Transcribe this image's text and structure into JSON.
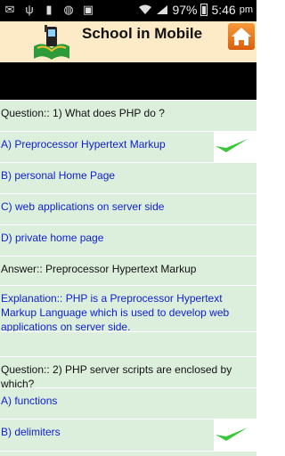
{
  "status": {
    "battery": "97%",
    "time": "5:46",
    "ampm": "pm"
  },
  "app": {
    "title": "School in Mobile"
  },
  "q1": {
    "question": "Question::  1)  What does  PHP  do ?",
    "options": [
      "A)  Preprocessor Hypertext Markup",
      "B)  personal Home Page",
      "C)  web applications on server side",
      "D)  private home page"
    ],
    "answer": "Answer::   Preprocessor Hypertext Markup",
    "explanation": "Explanation::  PHP is a Preprocessor Hypertext Markup Language which is used to develop web applications  on server side."
  },
  "q2": {
    "question": "Question::  2)  PHP server scripts are enclosed by which?",
    "options": [
      "A)  functions",
      "B)  delimiters"
    ]
  },
  "colors": {
    "header_bg": "#fdebc7",
    "row_bg": "#dcefdc",
    "option_text": "#1020d0",
    "check": "#3cc63c",
    "home_button": "#e8771f"
  }
}
